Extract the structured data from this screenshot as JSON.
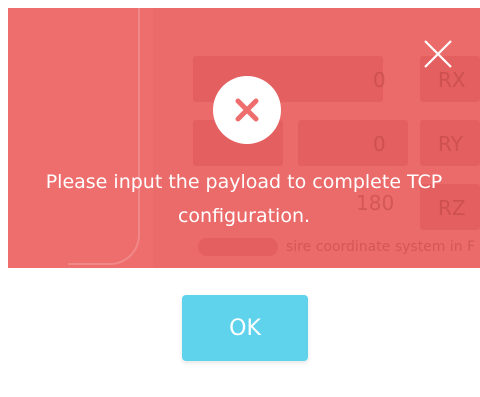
{
  "dialog": {
    "message_line1": "Please input the payload to complete TCP",
    "message_line2": "configuration.",
    "ok_label": "OK",
    "close_icon": "close-icon",
    "status_icon": "error-x-icon"
  },
  "background_ui": {
    "label_rx": "RX",
    "label_ry": "RY",
    "label_rz": "RZ",
    "value_1": "0",
    "value_2": "0",
    "value_3": "180",
    "footer_text": "sire coordinate system in F"
  },
  "colors": {
    "banner": "#ee6e6e",
    "error_icon": "#ee6e6e",
    "button": "#5fd3ec",
    "text_on_banner": "#ffffff"
  }
}
